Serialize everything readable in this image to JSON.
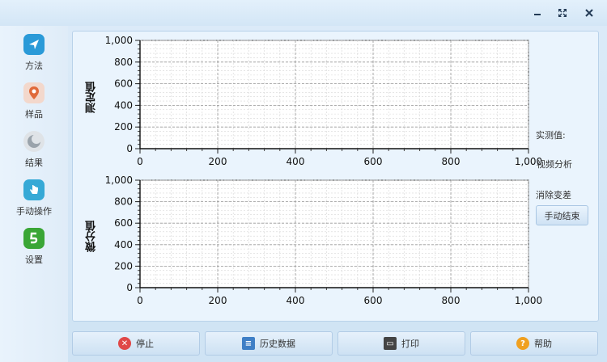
{
  "window": {
    "minimize_icon": "minimize-icon",
    "maximize_icon": "maximize-icon",
    "close_icon": "close-icon"
  },
  "sidebar": {
    "items": [
      {
        "label": "方法",
        "icon": "send-icon",
        "color": "#2a9ad8"
      },
      {
        "label": "样品",
        "icon": "location-pin-icon",
        "color": "#e06a3a"
      },
      {
        "label": "结果",
        "icon": "moon-icon",
        "color": "#9aa3ab"
      },
      {
        "label": "手动操作",
        "icon": "hand-icon",
        "color": "#36a9d6"
      },
      {
        "label": "设置",
        "icon": "five-icon",
        "color": "#3aa636"
      }
    ]
  },
  "charts": [
    {
      "ylabel": "测定值",
      "yticks": [
        "0",
        "200",
        "400",
        "600",
        "800",
        "1,000"
      ],
      "xticks": [
        "0",
        "200",
        "400",
        "600",
        "800",
        "1,000"
      ]
    },
    {
      "ylabel": "微分值",
      "yticks": [
        "0",
        "200",
        "400",
        "600",
        "800",
        "1,000"
      ],
      "xticks": [
        "0",
        "200",
        "400",
        "600",
        "800",
        "1,000"
      ]
    }
  ],
  "chart_data": [
    {
      "type": "line",
      "title": "",
      "xlabel": "",
      "ylabel": "测定值",
      "xlim": [
        0,
        1000
      ],
      "ylim": [
        0,
        1000
      ],
      "grid": true,
      "series": []
    },
    {
      "type": "line",
      "title": "",
      "xlabel": "",
      "ylabel": "微分值",
      "xlim": [
        0,
        1000
      ],
      "ylim": [
        0,
        1000
      ],
      "grid": true,
      "series": []
    }
  ],
  "right_panel": {
    "measured_label": "实测值:",
    "video_label": "视频分析",
    "clear_label": "消除变差",
    "manual_end_button": "手动结束"
  },
  "bottom": {
    "stop": "停止",
    "history": "历史数据",
    "print": "打印",
    "help": "帮助"
  },
  "colors": {
    "stop": "#e04848",
    "history": "#3f7fc6",
    "print": "#444444",
    "help": "#f0a020"
  }
}
